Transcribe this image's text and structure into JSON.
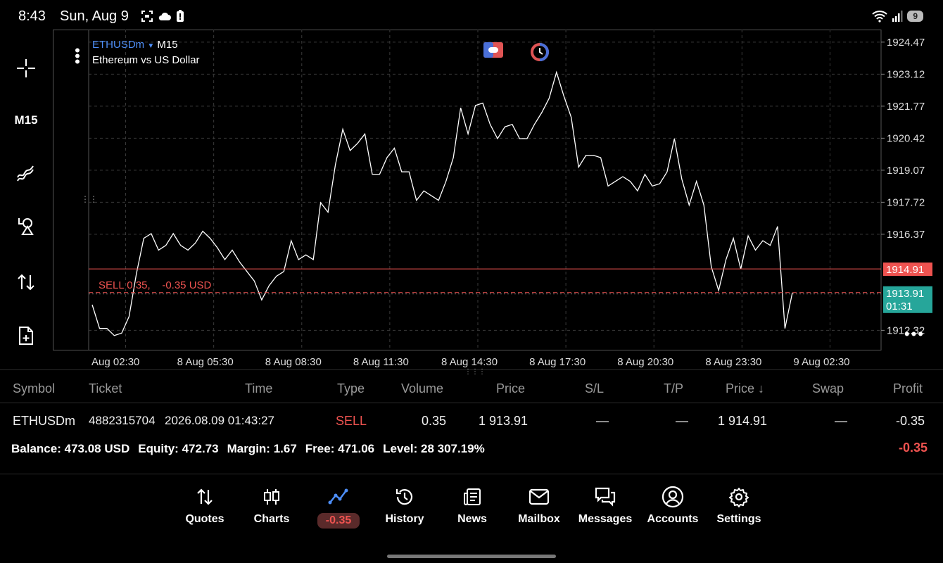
{
  "status_bar": {
    "time": "8:43",
    "date": "Sun, Aug 9",
    "battery": "9"
  },
  "left_toolbar": {
    "timeframe": "M15",
    "tools": [
      "crosshair-icon",
      "indicators-icon",
      "objects-icon",
      "trade-icon",
      "new-order-icon"
    ]
  },
  "chart": {
    "symbol": "ETHUSDm",
    "timeframe": "M15",
    "description": "Ethereum vs US Dollar",
    "sell_line_label": "SELL 0.35,    -0.35 USD",
    "ask_price": "1914.91",
    "bid_price": "1913.91",
    "bid_timer": "01:31",
    "colors": {
      "ask": "#ef5350",
      "bid": "#26a69a",
      "line": "#ffffff",
      "grid": "#3a3a3a",
      "symbol": "#4d8ef7"
    }
  },
  "chart_data": {
    "type": "line",
    "y_ticks": [
      "1924.47",
      "1923.12",
      "1921.77",
      "1920.42",
      "1919.07",
      "1917.72",
      "1916.37",
      "1912.32"
    ],
    "ylim": [
      1911.5,
      1925.0
    ],
    "x_ticks": [
      "Aug 02:30",
      "8 Aug 05:30",
      "8 Aug 08:30",
      "8 Aug 11:30",
      "8 Aug 14:30",
      "8 Aug 17:30",
      "8 Aug 20:30",
      "8 Aug 23:30",
      "9 Aug 02:30"
    ],
    "values": [
      1913.4,
      1912.4,
      1912.4,
      1912.1,
      1912.2,
      1912.9,
      1914.7,
      1916.2,
      1916.4,
      1915.7,
      1915.9,
      1916.4,
      1915.9,
      1915.7,
      1916.0,
      1916.5,
      1916.2,
      1915.8,
      1915.3,
      1915.7,
      1915.2,
      1914.8,
      1914.4,
      1913.6,
      1914.2,
      1914.6,
      1914.8,
      1916.1,
      1915.3,
      1915.5,
      1915.3,
      1917.7,
      1917.3,
      1919.3,
      1920.8,
      1919.9,
      1920.2,
      1920.6,
      1918.9,
      1918.9,
      1919.6,
      1920.0,
      1919.0,
      1919.0,
      1917.8,
      1918.2,
      1918.0,
      1917.8,
      1918.6,
      1919.6,
      1921.7,
      1920.6,
      1921.8,
      1921.9,
      1921.0,
      1920.4,
      1920.9,
      1921.0,
      1920.4,
      1920.4,
      1921.0,
      1921.5,
      1922.1,
      1923.2,
      1922.2,
      1921.3,
      1919.2,
      1919.7,
      1919.7,
      1919.6,
      1918.4,
      1918.6,
      1918.8,
      1918.6,
      1918.2,
      1918.9,
      1918.4,
      1918.5,
      1919.0,
      1920.4,
      1918.7,
      1917.6,
      1918.6,
      1917.6,
      1915.0,
      1914.0,
      1915.3,
      1916.2,
      1914.9,
      1916.3,
      1915.7,
      1916.1,
      1915.9,
      1916.7,
      1912.4,
      1913.9
    ]
  },
  "table": {
    "headers": [
      "Symbol",
      "Ticket",
      "Time",
      "Type",
      "Volume",
      "Price",
      "S/L",
      "T/P",
      "Price ↓",
      "Swap",
      "Profit"
    ],
    "row": {
      "symbol": "ETHUSDm",
      "ticket": "4882315704",
      "time": "2026.08.09 01:43:27",
      "type": "SELL",
      "volume": "0.35",
      "price": "1 913.91",
      "sl": "—",
      "tp": "—",
      "current_price": "1 914.91",
      "swap": "—",
      "profit": "-0.35"
    },
    "summary": {
      "balance_label": "Balance:",
      "balance": "473.08 USD",
      "equity_label": "Equity:",
      "equity": "472.73",
      "margin_label": "Margin:",
      "margin": "1.67",
      "free_label": "Free:",
      "free": "471.06",
      "level_label": "Level:",
      "level": "28 307.19%",
      "total_profit": "-0.35"
    }
  },
  "nav": {
    "quotes": "Quotes",
    "charts": "Charts",
    "trade_profit": "-0.35",
    "history": "History",
    "news": "News",
    "mailbox": "Mailbox",
    "messages": "Messages",
    "accounts": "Accounts",
    "settings": "Settings"
  }
}
